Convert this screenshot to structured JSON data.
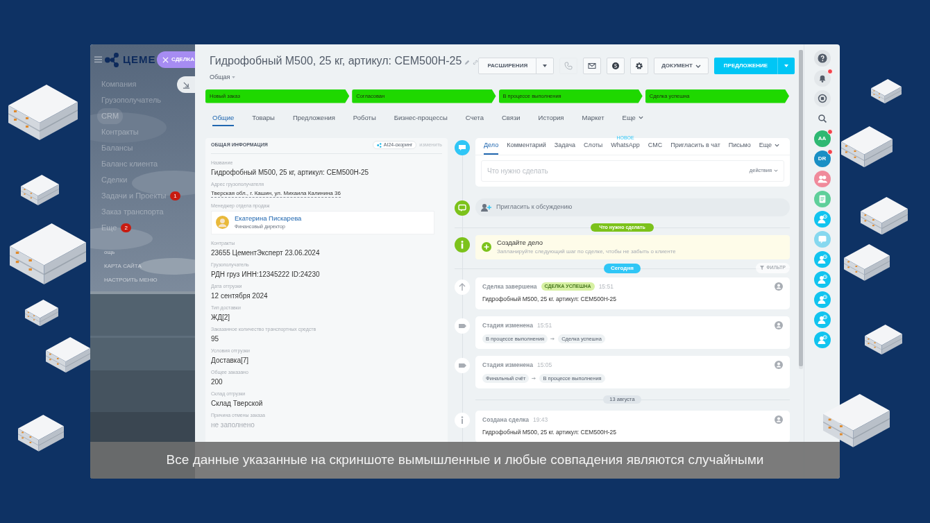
{
  "brand": {
    "logo_text": "ЦЕМЕ",
    "entity_chip": "СДЕЛКА"
  },
  "sidebar": {
    "items": [
      {
        "label": "Компания",
        "selected": false
      },
      {
        "label": "Грузополучатель",
        "selected": false
      },
      {
        "label": "CRM",
        "selected": true
      },
      {
        "label": "Контракты",
        "selected": false
      },
      {
        "label": "Балансы",
        "selected": false
      },
      {
        "label": "Баланс клиента",
        "selected": false
      },
      {
        "label": "Сделки",
        "selected": false
      },
      {
        "label": "Задачи и Проекты",
        "selected": false,
        "count": "1"
      },
      {
        "label": "Заказ транспорта",
        "selected": false
      },
      {
        "label": "Еще",
        "selected": false,
        "count": "2"
      }
    ],
    "footer_links": [
      "ощь",
      "КАРТА САЙТА",
      "НАСТРОИТЬ МЕНЮ"
    ]
  },
  "deal": {
    "title": "Гидрофобный М500, 25 кг, артикул: CEM500H-25",
    "category": "Общая"
  },
  "toolbar": {
    "extensions": "РАСШИРЕНИЯ",
    "icon_buttons": [
      {
        "kind": "phone",
        "disabled": true
      },
      {
        "kind": "mail",
        "disabled": false
      },
      {
        "kind": "skype",
        "disabled": false
      },
      {
        "kind": "gear",
        "disabled": false
      }
    ],
    "document": "ДОКУМЕНТ",
    "primary": "ПРЕДЛОЖЕНИЕ"
  },
  "stages": [
    {
      "label": "Новый заказ",
      "done": true
    },
    {
      "label": "Согласован",
      "done": true
    },
    {
      "label": "В процессе выполнения",
      "done": true
    },
    {
      "label": "Сделка успешна",
      "done": true
    }
  ],
  "tabs": [
    {
      "label": "Общие",
      "selected": true
    },
    {
      "label": "Товары",
      "selected": false
    },
    {
      "label": "Предложения",
      "selected": false
    },
    {
      "label": "Роботы",
      "selected": false
    },
    {
      "label": "Бизнес-процессы",
      "selected": false
    },
    {
      "label": "Счета",
      "selected": false
    },
    {
      "label": "Связи",
      "selected": false
    },
    {
      "label": "История",
      "selected": false
    },
    {
      "label": "Маркет",
      "selected": false
    },
    {
      "label": "Еще",
      "selected": false,
      "dropdown": true
    }
  ],
  "info_card": {
    "title": "ОБЩАЯ ИНФОРМАЦИЯ",
    "scoring": "AI24-скоринг",
    "edit": "изменить",
    "fields": [
      {
        "kind": "text",
        "label": "Название",
        "value": "Гидрофобный М500, 25 кг, артикул: CEM500H-25"
      },
      {
        "kind": "link",
        "label": "Адрес грузополучателя",
        "value": "Тверская обл., г. Кашин, ул. Михаила Калинина 36"
      },
      {
        "kind": "person",
        "label": "Менеджер отдела продаж",
        "name": "Екатерина Пискарева",
        "position": "Финансовый директор"
      },
      {
        "kind": "text",
        "label": "Контракты",
        "value": "23655 ЦементЭксперт 23.06.2024"
      },
      {
        "kind": "text",
        "label": "Грузополучатель",
        "value": "РДН груз ИНН:12345222 ID:24230"
      },
      {
        "kind": "text",
        "label": "Дата отгрузки",
        "value": "12 сентября 2024"
      },
      {
        "kind": "text",
        "label": "Тип доставки",
        "value": "ЖД[2]"
      },
      {
        "kind": "text",
        "label": "Заказанное количество транспортных средств",
        "value": "95"
      },
      {
        "kind": "text",
        "label": "Условия отгрузки",
        "value": "Доставка[7]"
      },
      {
        "kind": "text",
        "label": "Общее заказано",
        "value": "200"
      },
      {
        "kind": "text",
        "label": "Склад отгрузки",
        "value": "Склад Тверской"
      },
      {
        "kind": "empty",
        "label": "Причина отмены заказа",
        "value": "не заполнено"
      }
    ]
  },
  "timeline": {
    "composer": {
      "tabs": [
        {
          "label": "Дело",
          "selected": true
        },
        {
          "label": "Комментарий",
          "selected": false
        },
        {
          "label": "Задача",
          "selected": false
        },
        {
          "label": "Слоты",
          "selected": false
        },
        {
          "label": "WhatsApp",
          "selected": false,
          "badge": "НОВОЕ"
        },
        {
          "label": "СМС",
          "selected": false
        },
        {
          "label": "Пригласить в чат",
          "selected": false
        },
        {
          "label": "Письмо",
          "selected": false
        },
        {
          "label": "Еще",
          "selected": false,
          "dropdown": true
        }
      ],
      "placeholder": "Что нужно сделать",
      "actions": "действия"
    },
    "invite": "Пригласить к обсуждению",
    "todo_divider": "Что нужно сделать",
    "hint": {
      "title": "Создайте дело",
      "text": "Запланируйте следующий шаг по сделке, чтобы не забыть о клиенте"
    },
    "today": "Сегодня",
    "filter": "ФИЛЬТР",
    "events": [
      {
        "kind": "complete",
        "title": "Сделка завершена",
        "tag": "СДЕЛКА УСПЕШНА",
        "time": "15:51",
        "text": "Гидрофобный М500, 25 кг. артикул: CEM500H-25"
      },
      {
        "kind": "stage",
        "title": "Стадия изменена",
        "time": "15:51",
        "from": "В процессе выполнения",
        "to": "Сделка успешна"
      },
      {
        "kind": "stage",
        "title": "Стадия изменена",
        "time": "15:05",
        "from": "Финальный счёт",
        "to": "В процессе выполнения"
      },
      {
        "kind": "date",
        "label": "13 августа"
      },
      {
        "kind": "created",
        "title": "Создана сделка",
        "time": "19:43",
        "text": "Гидрофобный М500, 25 кг. артикул: CEM500H-25"
      }
    ]
  },
  "rail": [
    {
      "kind": "help"
    },
    {
      "kind": "bell",
      "badge": true
    },
    {
      "kind": "chat"
    },
    {
      "kind": "search"
    },
    {
      "kind": "avatar",
      "initials": "AA",
      "color": "#2eb872",
      "badge": true
    },
    {
      "kind": "avatar",
      "initials": "DR",
      "color": "#1a8fc4",
      "badge": true
    },
    {
      "kind": "group",
      "color": "#f08a9b"
    },
    {
      "kind": "doc",
      "color": "#5fcf9a"
    },
    {
      "kind": "user_clock",
      "color": "#11c4ef"
    },
    {
      "kind": "chat_bubble",
      "color": "#86d8ef"
    },
    {
      "kind": "user_clock",
      "color": "#11c4ef"
    },
    {
      "kind": "user_clock",
      "color": "#11c4ef"
    },
    {
      "kind": "user_clock",
      "color": "#11c4ef"
    },
    {
      "kind": "user_clock",
      "color": "#11c4ef"
    },
    {
      "kind": "user_clock",
      "color": "#11c4ef"
    }
  ],
  "disclaimer": "Все данные указанные на скриншоте вымышленные и любые совпадения являются случайными"
}
